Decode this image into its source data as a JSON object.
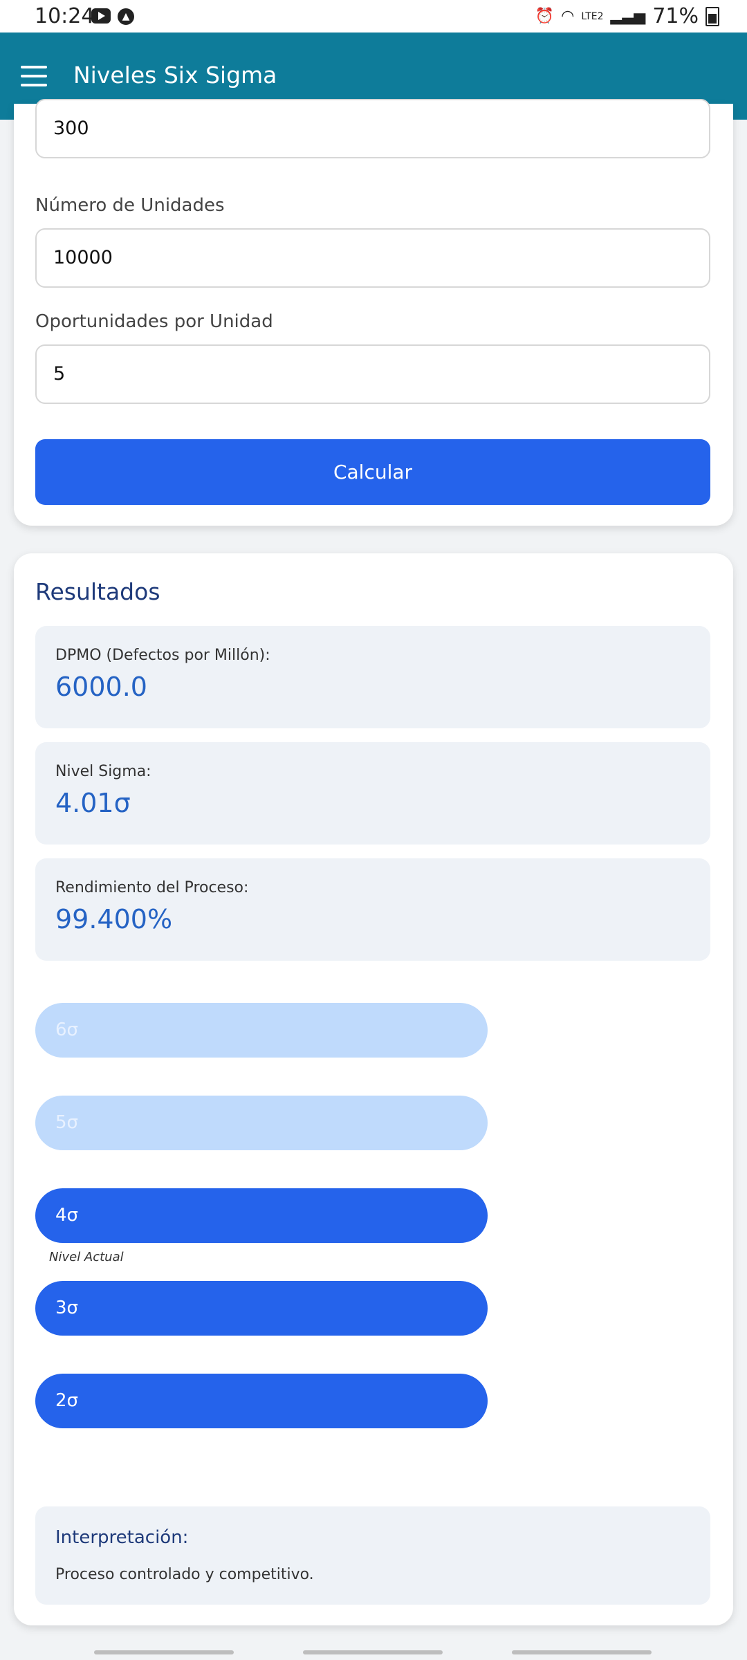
{
  "status_bar": {
    "time": "10:24",
    "battery": "71%",
    "icons": [
      "youtube-icon",
      "app-icon",
      "alarm-icon",
      "wifi-icon",
      "lte-icon",
      "signal-icon",
      "battery-icon"
    ]
  },
  "app_bar": {
    "title": "Niveles Six Sigma"
  },
  "inputs": {
    "defects_value": "300",
    "units_label": "Número de Unidades",
    "units_value": "10000",
    "opportunities_label": "Oportunidades por Unidad",
    "opportunities_value": "5",
    "calculate_label": "Calcular"
  },
  "results": {
    "title": "Resultados",
    "dpmo_label": "DPMO (Defectos por Millón):",
    "dpmo_value": "6000.0",
    "sigma_label": "Nivel Sigma:",
    "sigma_value": "4.01σ",
    "yield_label": "Rendimiento del Proceso:",
    "yield_value": "99.400%"
  },
  "sigma_levels": [
    {
      "label": "6σ",
      "active": false
    },
    {
      "label": "5σ",
      "active": false
    },
    {
      "label": "4σ",
      "active": true
    },
    {
      "label": "3σ",
      "active": true
    },
    {
      "label": "2σ",
      "active": true
    }
  ],
  "current_level_note": "Nivel Actual",
  "interpretation": {
    "title": "Interpretación:",
    "text": "Proceso controlado y competitivo."
  },
  "colors": {
    "app_bar": "#0e7c9a",
    "primary": "#2563eb",
    "inactive_level": "#bfdafc",
    "result_value": "#2563c4"
  }
}
